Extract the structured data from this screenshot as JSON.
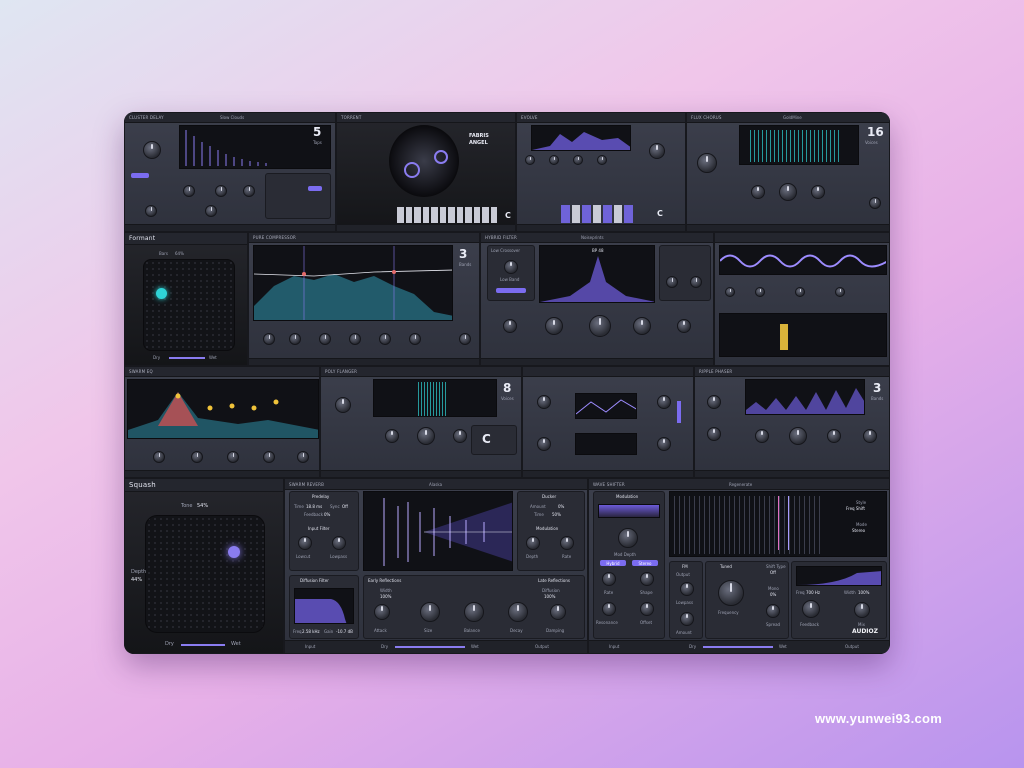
{
  "panels": {
    "p1": {
      "title": "CLUSTER DELAY",
      "preset": "Slow Clouds",
      "number": "5",
      "unit": "Taps"
    },
    "p2": {
      "title": "TORRENT",
      "name_line1": "FABRIS",
      "name_line2": "ANGEL",
      "key": "C"
    },
    "p3": {
      "title": "EVOLVE",
      "key": "C"
    },
    "p4": {
      "title": "FLUX CHORUS",
      "preset": "GoldMine",
      "number": "16",
      "unit": "Voices"
    },
    "formant": {
      "title": "Formant",
      "bars": "Bars",
      "value": "64%",
      "dry": "Dry",
      "wet": "Wet"
    },
    "pure": {
      "title": "PURE COMPRESSOR",
      "preset": "Fatty And Chill",
      "number": "3",
      "unit": "Bands"
    },
    "hybrid": {
      "title": "HYBRID FILTER",
      "preset": "Noiseprints",
      "section": "Low Crossover",
      "sub": "Low Band",
      "filter": "BP 48"
    },
    "swarm": {
      "title": "SWARM EQ"
    },
    "poly": {
      "title": "POLY FLANGER",
      "number": "8",
      "unit": "Voices",
      "key": "C"
    },
    "ripple": {
      "title": "RIPPLE PHASER",
      "number": "3",
      "unit": "Bands"
    },
    "squash": {
      "title": "Squash",
      "tone_label": "Tone",
      "tone_value": "54%",
      "depth_label": "Depth",
      "depth_value": "44%",
      "dry": "Dry",
      "wet": "Wet"
    },
    "swarm_reverb": {
      "title": "SWARM REVERB",
      "preset": "Alaska",
      "predelay": "Predelay",
      "time_label": "Time",
      "time_value": "18.8 ms",
      "sync_label": "Sync",
      "sync_value": "Off",
      "feedback_label": "Feedback",
      "feedback_value": "0%",
      "input_filter": "Input Filter",
      "lowcut": "Lowcut",
      "lowpass": "Lowpass",
      "ducker": "Ducker",
      "amount_label": "Amount",
      "amount_value": "0%",
      "time2_label": "Time",
      "time2_value": "50%",
      "modulation": "Modulation",
      "depth": "Depth",
      "rate": "Rate",
      "diffusion_filter": "Diffusion Filter",
      "freq_label": "Freq",
      "freq_value": "2.58 kHz",
      "gain_label": "Gain",
      "gain_value": "-10.7 dB",
      "early": "Early Reflections",
      "late": "Late Reflections",
      "width_label": "Width",
      "width_value": "100%",
      "diffusion_label": "Diffusion",
      "diffusion_value": "100%",
      "attack": "Attack",
      "size": "Size",
      "balance": "Balance",
      "decay": "Decay",
      "damping": "Damping",
      "dry": "Dry",
      "wet": "Wet",
      "output": "Output",
      "input": "Input"
    },
    "wave": {
      "title": "WAVE SHIFTER",
      "preset": "Regenerate",
      "modulation": "Modulation",
      "mod_depth": "Mod Depth",
      "btn1": "Hybrid",
      "btn2": "Stereo",
      "rate": "Rate",
      "shape": "Shape",
      "resonance": "Resonance",
      "offset": "Offset",
      "fm": "FM",
      "output": "Output",
      "lowpass": "Lowpass",
      "amount": "Amount",
      "tuned": "Tuned",
      "shift_type_label": "Shift Type",
      "shift_type_value": "Off",
      "frequency": "Frequency",
      "mono_label": "Mono",
      "mono_value": "0%",
      "spread": "Spread",
      "style_label": "Style",
      "style_value": "Freq Shift",
      "mode_label": "Mode",
      "mode_value": "Stereo",
      "freq_label": "Freq",
      "freq_value": "700 Hz",
      "width_label": "Width",
      "width_value": "100%",
      "feedback": "Feedback",
      "mix": "Mix",
      "brand": "AUDIOZ",
      "dry": "Dry",
      "wet": "Wet",
      "input": "Input",
      "output2": "Output"
    }
  },
  "watermark": "www.yunwei93.com",
  "colors": {
    "accent": "#7b6cf0",
    "cyan": "#2fd3d6",
    "panel": "#34374a"
  }
}
